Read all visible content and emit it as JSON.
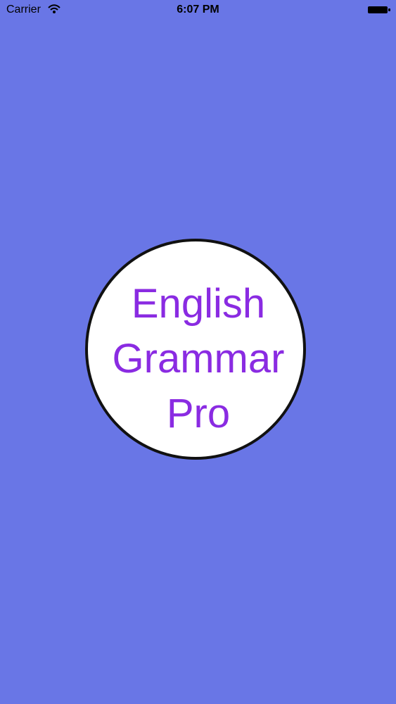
{
  "status_bar": {
    "carrier": "Carrier",
    "time": "6:07 PM",
    "wifi_icon": "wifi-icon",
    "battery_icon": "battery-icon"
  },
  "splash": {
    "title_lines": [
      "English",
      "Grammar",
      "Pro"
    ]
  },
  "colors": {
    "background": "#6976e6",
    "circle_fill": "#ffffff",
    "circle_border": "#111111",
    "logo_text": "#8a2be2"
  }
}
